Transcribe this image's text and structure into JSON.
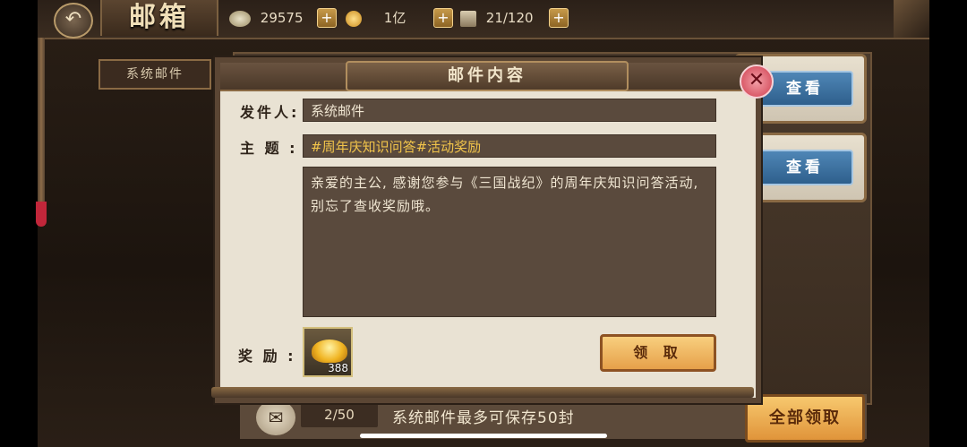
{
  "header": {
    "title": "邮箱",
    "resources": [
      {
        "icon": "silver-ingot-icon",
        "value": "29575"
      },
      {
        "icon": "gold-coin-icon",
        "value": "1亿"
      },
      {
        "icon": "troop-capacity-icon",
        "value": "21/120"
      }
    ],
    "plus_label": "+",
    "back_glyph": "↶"
  },
  "sidebar": {
    "tab_label": "系统邮件"
  },
  "list": {
    "view_label": "查看",
    "mail_count": "2/50",
    "limit_note": "系统邮件最多可保存50封",
    "claim_all_label": "全部领取"
  },
  "modal": {
    "title": "邮件内容",
    "close_glyph": "✕",
    "sender_label": "发件人:",
    "sender_value": "系统邮件",
    "subject_label": "主 题 :",
    "subject_value": "#周年庆知识问答#活动奖励",
    "body_text": "亲爱的主公, 感谢您参与《三国战纪》的周年庆知识问答活动,别忘了查收奖励哦。",
    "reward_label": "奖 励 :",
    "reward_item": {
      "icon": "gold-ingot-icon",
      "quantity": "388"
    },
    "claim_label": "领 取"
  },
  "colors": {
    "accent_gold": "#f1c44a",
    "panel_bg": "#e9e2d3",
    "field_bg": "#5a4a3d",
    "button_orange": "#e6a04a",
    "view_blue": "#2e5f8c",
    "close_red": "#cf3d4e"
  }
}
